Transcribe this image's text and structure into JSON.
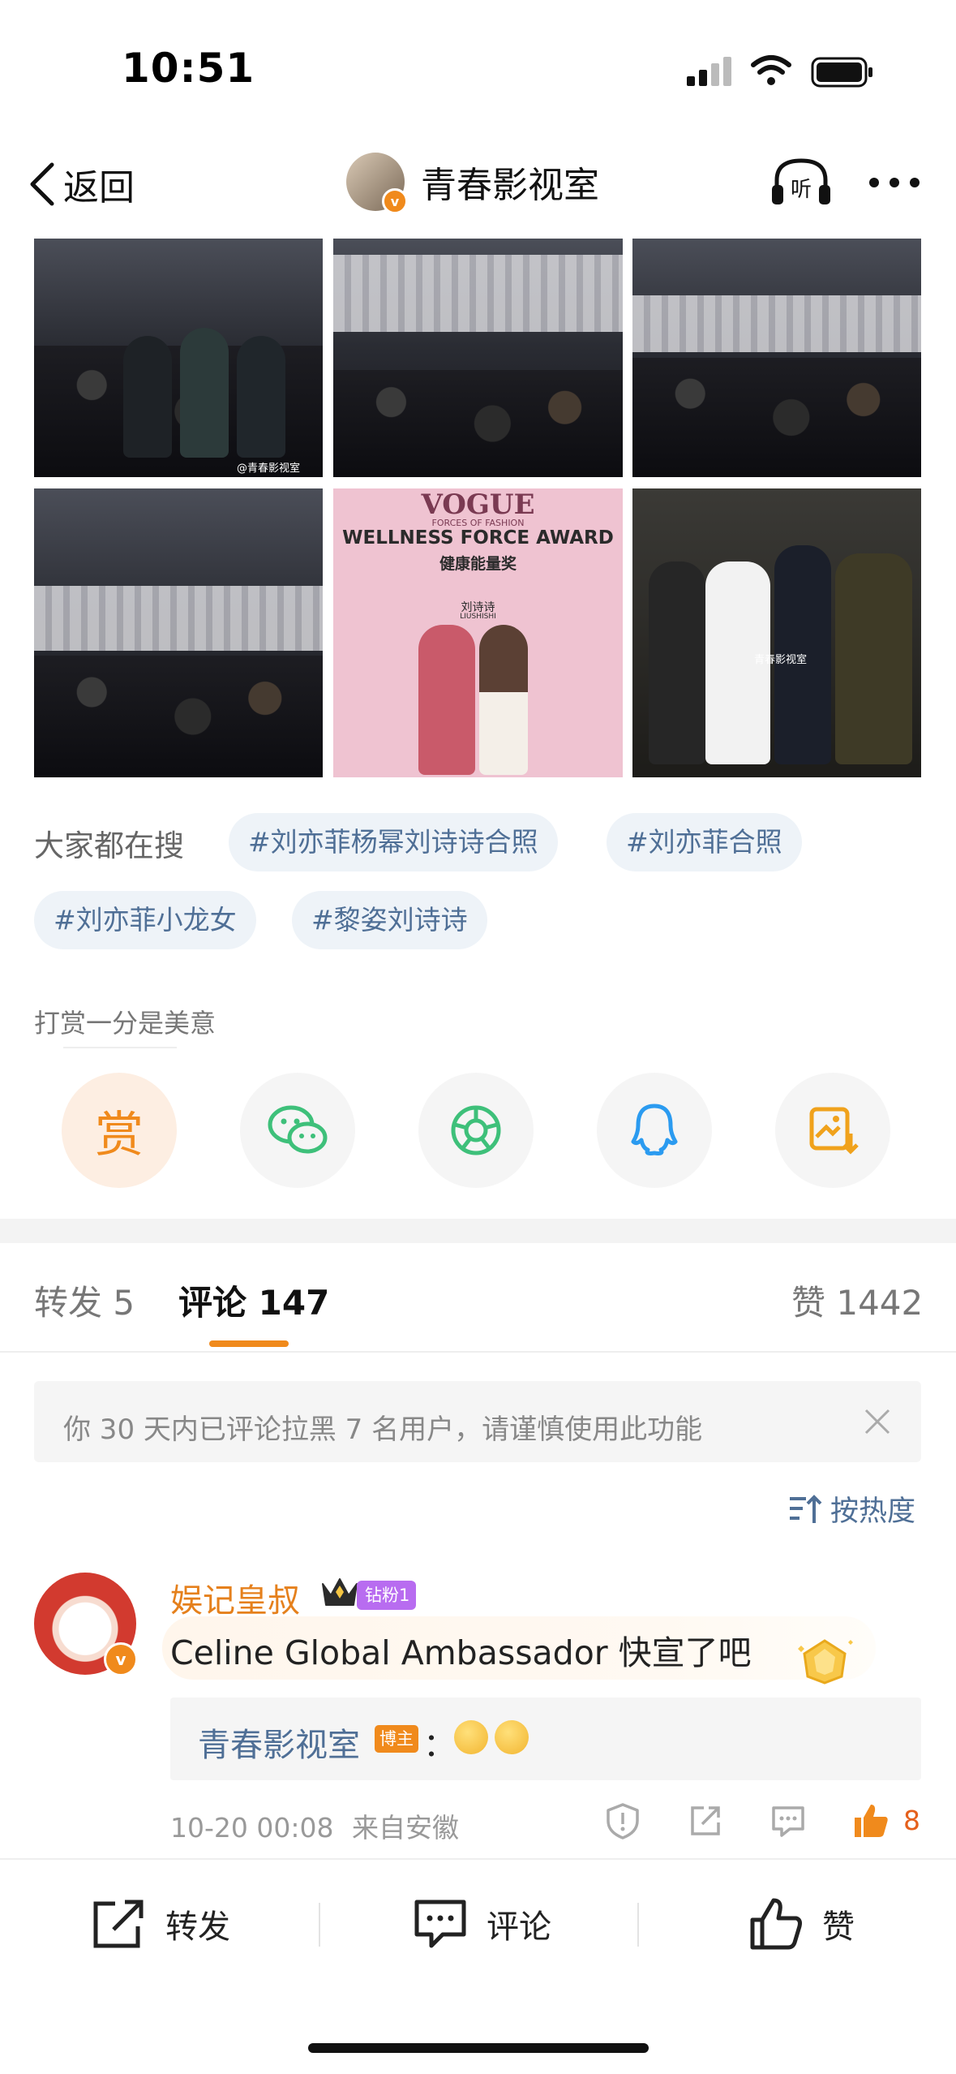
{
  "status_bar": {
    "time": "10:51"
  },
  "nav": {
    "back_label": "返回",
    "title": "青春影视室",
    "verified_badge": "v",
    "listen_label": "听"
  },
  "photos": {
    "watermark_1": "@青春影视室",
    "vogue_logo": "VOGUE",
    "vogue_sub": "FORCES OF FASHION",
    "award_en": "WELLNESS FORCE AWARD",
    "award_cn": "健康能量奖",
    "name_cn": "刘诗诗",
    "name_en": "LIUSHISHI",
    "watermark_6": "青春影视室"
  },
  "search": {
    "label": "大家都在搜",
    "tags": [
      "#刘亦菲杨幂刘诗诗合照",
      "#刘亦菲合照",
      "#刘亦菲小龙女",
      "#黎姿刘诗诗"
    ]
  },
  "reward": {
    "label": "打赏一分是美意",
    "reward_char": "赏",
    "share_icons": [
      "reward-icon",
      "wechat-icon",
      "moments-icon",
      "qq-icon",
      "save-image-icon"
    ]
  },
  "tabs": {
    "forward": "转发 5",
    "comment": "评论 147",
    "like": "赞 1442"
  },
  "notice": {
    "text": "你 30 天内已评论拉黑 7 名用户，请谨慎使用此功能"
  },
  "sort": {
    "label": "按热度"
  },
  "comment": {
    "author": "娱记皇叔",
    "verified_badge": "v",
    "fan_badge": "钻粉1",
    "text": "Celine Global Ambassador 快宣了吧",
    "reply": {
      "author": "青春影视室",
      "badge": "博主",
      "colon": "："
    },
    "time": "10-20 00:08",
    "location": "来自安徽",
    "like_count": "8"
  },
  "bottom_bar": {
    "forward": "转发",
    "comment": "评论",
    "like": "赞"
  },
  "colors": {
    "accent": "#f08a1c",
    "link": "#4f6f96",
    "like": "#e5601c",
    "fan_badge": "#b86cf0"
  }
}
